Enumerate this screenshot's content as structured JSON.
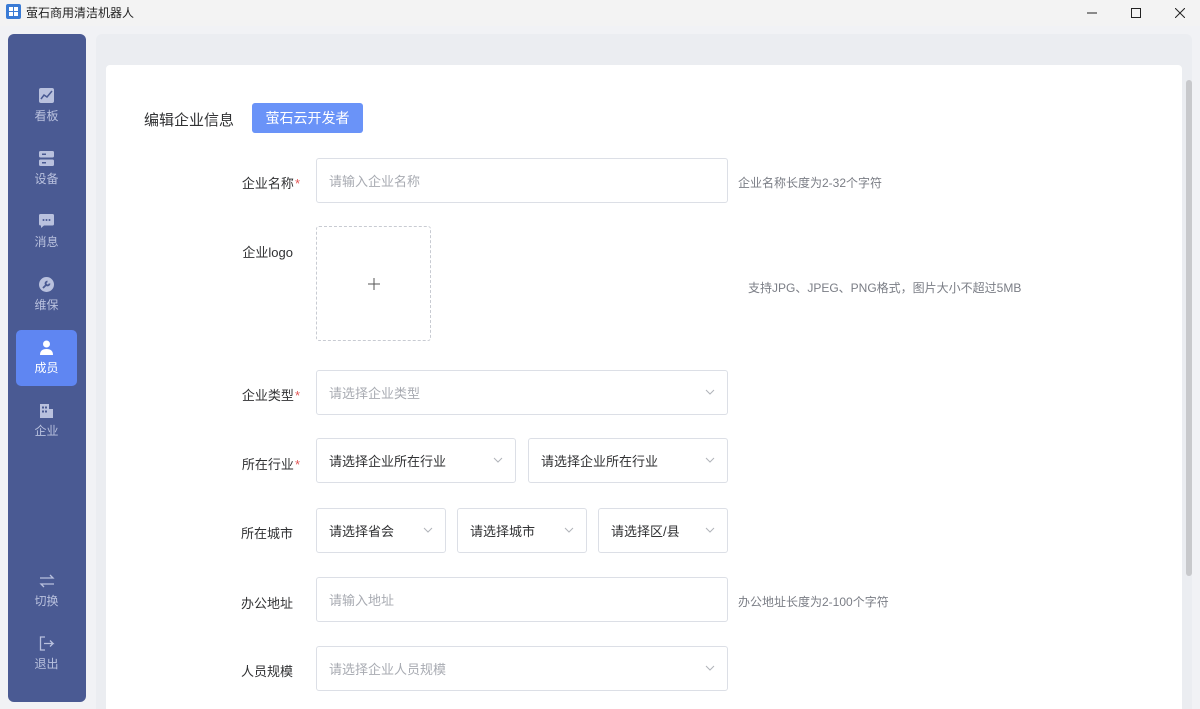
{
  "window": {
    "title": "萤石商用清洁机器人",
    "minimize": "—",
    "maximize": "☐",
    "close": "✕"
  },
  "sidebar": {
    "items": [
      {
        "label": "看板",
        "icon": "chart-icon"
      },
      {
        "label": "设备",
        "icon": "server-icon"
      },
      {
        "label": "消息",
        "icon": "message-icon"
      },
      {
        "label": "维保",
        "icon": "wrench-icon"
      },
      {
        "label": "成员",
        "icon": "user-icon",
        "active": true
      },
      {
        "label": "企业",
        "icon": "building-icon"
      }
    ],
    "bottom": [
      {
        "label": "切换",
        "icon": "switch-icon"
      },
      {
        "label": "退出",
        "icon": "logout-icon"
      }
    ]
  },
  "header": {
    "title": "编辑企业信息",
    "dev_button": "萤石云开发者"
  },
  "form": {
    "name": {
      "label": "企业名称",
      "required": "*",
      "placeholder": "请输入企业名称",
      "hint": "企业名称长度为2-32个字符"
    },
    "logo": {
      "label": "企业logo",
      "upload_symbol": "+",
      "hint": "支持JPG、JPEG、PNG格式，图片大小不超过5MB"
    },
    "type": {
      "label": "企业类型",
      "required": "*",
      "placeholder": "请选择企业类型"
    },
    "industry": {
      "label": "所在行业",
      "required": "*",
      "placeholder1": "请选择企业所在行业",
      "placeholder2": "请选择企业所在行业"
    },
    "city": {
      "label": "所在城市",
      "province": "请选择省会",
      "city": "请选择城市",
      "district": "请选择区/县"
    },
    "address": {
      "label": "办公地址",
      "placeholder": "请输入地址",
      "hint": "办公地址长度为2-100个字符"
    },
    "scale": {
      "label": "人员规模",
      "placeholder": "请选择企业人员规模"
    }
  },
  "colors": {
    "sidebar": "#4a5a93",
    "active": "#5f86f2",
    "button": "#6a93f8",
    "required": "#e25555"
  }
}
